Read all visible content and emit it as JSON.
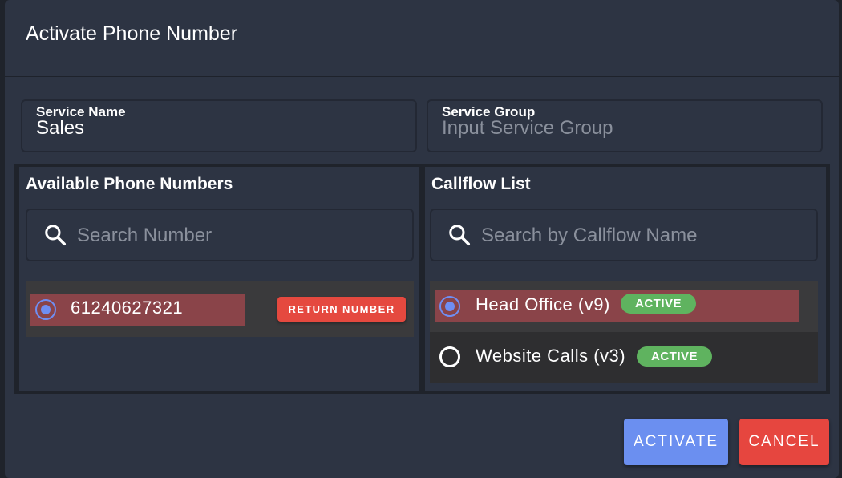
{
  "dialog": {
    "title": "Activate Phone Number"
  },
  "service_name": {
    "label": "Service Name",
    "value": "Sales"
  },
  "service_group": {
    "label": "Service Group",
    "placeholder": "Input Service Group"
  },
  "phone_panel": {
    "title": "Available Phone Numbers",
    "search_placeholder": "Search Number",
    "items": [
      {
        "number": "61240627321",
        "selected": true,
        "action_label": "RETURN NUMBER"
      }
    ]
  },
  "callflow_panel": {
    "title": "Callflow List",
    "search_placeholder": "Search by Callflow Name",
    "items": [
      {
        "name": "Head Office (v9)",
        "status": "ACTIVE",
        "selected": true
      },
      {
        "name": "Website Calls (v3)",
        "status": "ACTIVE",
        "selected": false
      }
    ]
  },
  "actions": {
    "activate_label": "ACTIVATE",
    "cancel_label": "CANCEL"
  },
  "colors": {
    "dialog_bg": "#2d3443",
    "selected_row": "#8a4449",
    "accent_blue": "#6b8ff0",
    "danger_red": "#e6463f",
    "badge_green": "#5fb35f"
  }
}
